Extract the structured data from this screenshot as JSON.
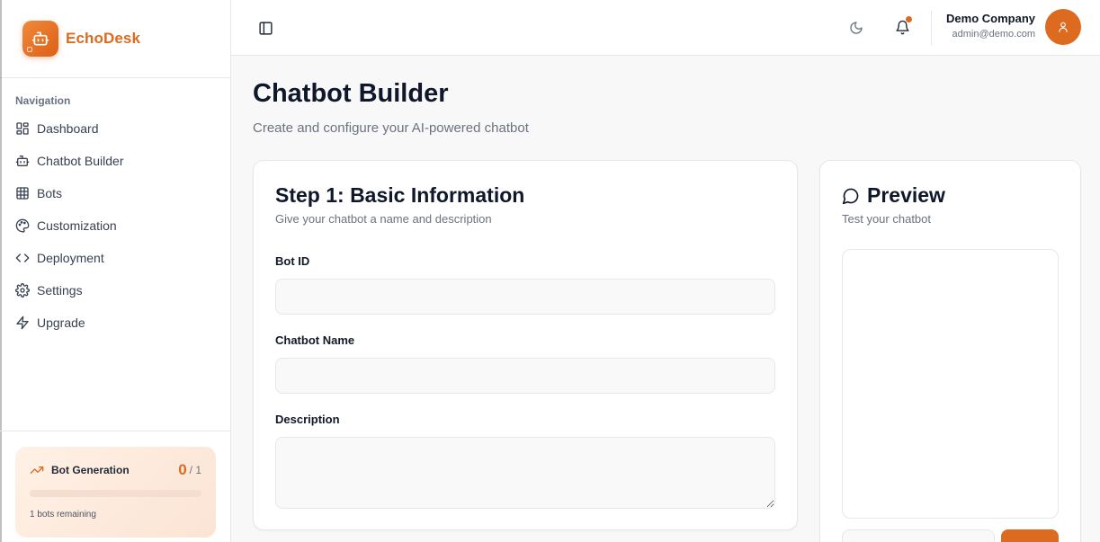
{
  "brand": {
    "name": "EchoDesk"
  },
  "sidebar": {
    "section_label": "Navigation",
    "items": [
      {
        "label": "Dashboard",
        "icon": "dashboard-icon"
      },
      {
        "label": "Chatbot Builder",
        "icon": "bot-icon"
      },
      {
        "label": "Bots",
        "icon": "grid-icon"
      },
      {
        "label": "Customization",
        "icon": "palette-icon"
      },
      {
        "label": "Deployment",
        "icon": "code-icon"
      },
      {
        "label": "Settings",
        "icon": "gear-icon"
      },
      {
        "label": "Upgrade",
        "icon": "lightning-icon"
      }
    ],
    "generation": {
      "title": "Bot Generation",
      "count": "0",
      "total": "/ 1",
      "progress_fraction": 0,
      "remaining": "1 bots remaining"
    }
  },
  "header": {
    "user_name": "Demo Company",
    "user_email": "admin@demo.com"
  },
  "page": {
    "title": "Chatbot Builder",
    "subtitle": "Create and configure your AI-powered chatbot"
  },
  "form": {
    "title": "Step 1: Basic Information",
    "description": "Give your chatbot a name and description",
    "bot_id_label": "Bot ID",
    "bot_id_value": "",
    "name_label": "Chatbot Name",
    "name_value": "",
    "description_label": "Description",
    "description_value": ""
  },
  "preview": {
    "title": "Preview",
    "subtitle": "Test your chatbot"
  },
  "colors": {
    "accent": "#dc6a1f",
    "background": "#f8f8f8",
    "card": "#ffffff",
    "border": "#e5e7eb"
  }
}
